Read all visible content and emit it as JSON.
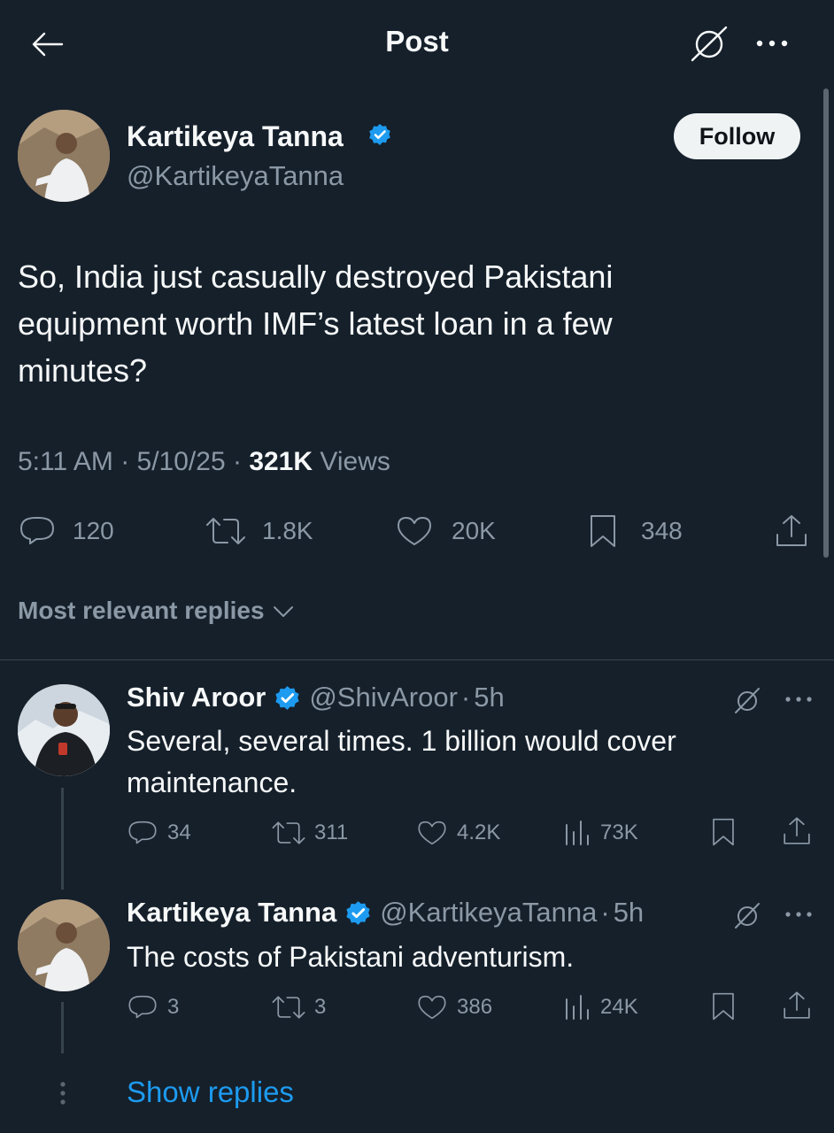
{
  "header": {
    "title": "Post"
  },
  "post": {
    "author_name": "Kartikeya Tanna",
    "author_handle": "@KartikeyaTanna",
    "follow_label": "Follow",
    "text": "So, India just casually destroyed Pakistani equipment worth IMF’s latest loan in a few minutes?",
    "time": "5:11 AM",
    "date": "5/10/25",
    "views_count": "321K",
    "views_label": "Views",
    "separator": "·",
    "stats": {
      "replies": "120",
      "reposts": "1.8K",
      "likes": "20K",
      "bookmarks": "348"
    }
  },
  "sort": {
    "label": "Most relevant replies"
  },
  "replies": [
    {
      "author_name": "Shiv Aroor",
      "author_handle": "@ShivAroor",
      "age": "5h",
      "text": "Several, several times. 1 billion would cover maintenance.",
      "stats": {
        "replies": "34",
        "reposts": "311",
        "likes": "4.2K",
        "views": "73K"
      }
    },
    {
      "author_name": "Kartikeya Tanna",
      "author_handle": "@KartikeyaTanna",
      "age": "5h",
      "text": "The costs of Pakistani adventurism.",
      "stats": {
        "replies": "3",
        "reposts": "3",
        "likes": "386",
        "views": "24K"
      }
    }
  ],
  "show_replies_label": "Show replies",
  "colors": {
    "background": "#15202b",
    "accent": "#1d9bf0",
    "muted": "#8b98a5",
    "text": "#f7f9f9"
  }
}
